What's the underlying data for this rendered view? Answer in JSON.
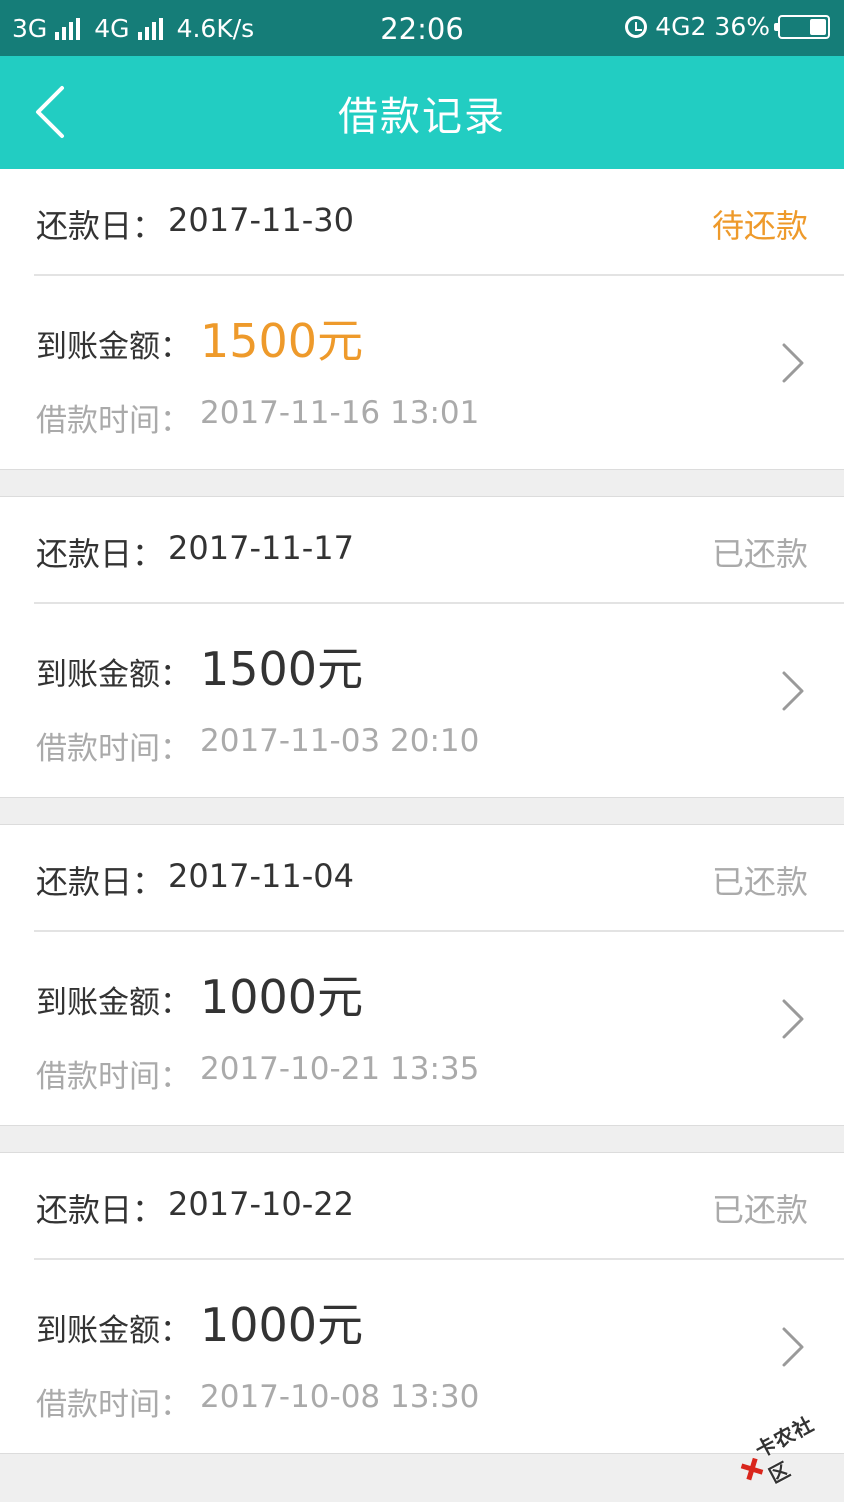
{
  "status_bar": {
    "network1": "3G",
    "network2": "4G",
    "speed": "4.6K/s",
    "time": "22:06",
    "network3": "4G2",
    "battery": "36%",
    "battery_level": 0.36
  },
  "nav": {
    "title": "借款记录",
    "back_icon": "chevron-left-icon"
  },
  "labels": {
    "due": "还款日：",
    "amount": "到账金额：",
    "time": "借款时间："
  },
  "records": [
    {
      "due_date": "2017-11-30",
      "status": "待还款",
      "amount": "1500元",
      "loan_time": "2017-11-16 13:01",
      "pending": true
    },
    {
      "due_date": "2017-11-17",
      "status": "已还款",
      "amount": "1500元",
      "loan_time": "2017-11-03 20:10",
      "pending": false
    },
    {
      "due_date": "2017-11-04",
      "status": "已还款",
      "amount": "1000元",
      "loan_time": "2017-10-21 13:35",
      "pending": false
    },
    {
      "due_date": "2017-10-22",
      "status": "已还款",
      "amount": "1000元",
      "loan_time": "2017-10-08 13:30",
      "pending": false
    }
  ],
  "colors": {
    "status_bar": "#157d78",
    "nav_bar": "#22cdc2",
    "pending": "#ee9a2b",
    "muted": "#aaaaaa"
  },
  "watermark": {
    "text": "卡农社区"
  }
}
